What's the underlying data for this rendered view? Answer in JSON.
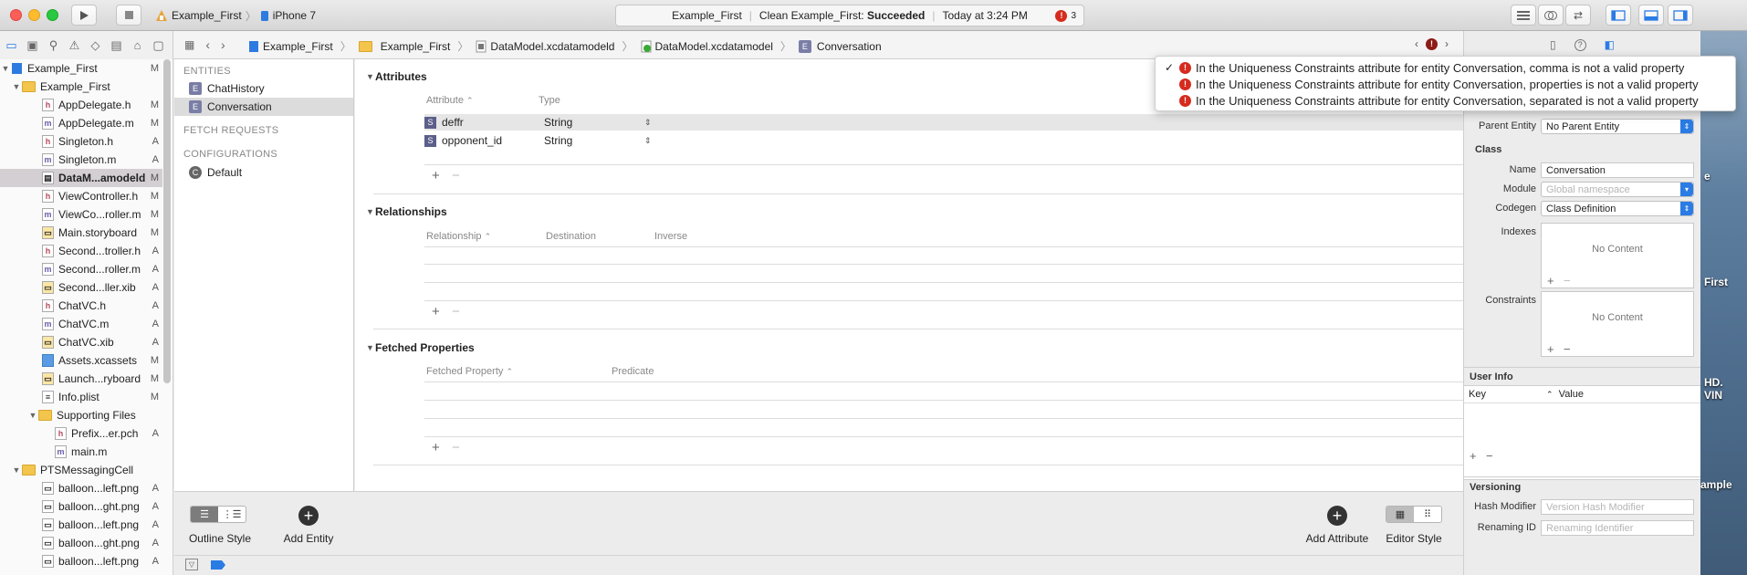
{
  "toolbar": {
    "scheme": "Example_First",
    "device": "iPhone 7",
    "activity_project": "Example_First",
    "activity_action": "Clean Example_First:",
    "activity_result": "Succeeded",
    "activity_time": "Today at 3:24 PM",
    "activity_error_count": "3"
  },
  "jumpbar": {
    "crumbs": [
      "Example_First",
      "Example_First",
      "DataModel.xcdatamodeld",
      "DataModel.xcdatamodel",
      "Conversation"
    ]
  },
  "navigator": {
    "items": [
      {
        "label": "Example_First",
        "status": "M"
      },
      {
        "label": "Example_First",
        "status": ""
      },
      {
        "label": "AppDelegate.h",
        "status": "M"
      },
      {
        "label": "AppDelegate.m",
        "status": "M"
      },
      {
        "label": "Singleton.h",
        "status": "A"
      },
      {
        "label": "Singleton.m",
        "status": "A"
      },
      {
        "label": "DataM...amodeld",
        "status": "M"
      },
      {
        "label": "ViewController.h",
        "status": "M"
      },
      {
        "label": "ViewCo...roller.m",
        "status": "M"
      },
      {
        "label": "Main.storyboard",
        "status": "M"
      },
      {
        "label": "Second...troller.h",
        "status": "A"
      },
      {
        "label": "Second...roller.m",
        "status": "A"
      },
      {
        "label": "Second...ller.xib",
        "status": "A"
      },
      {
        "label": "ChatVC.h",
        "status": "A"
      },
      {
        "label": "ChatVC.m",
        "status": "A"
      },
      {
        "label": "ChatVC.xib",
        "status": "A"
      },
      {
        "label": "Assets.xcassets",
        "status": "M"
      },
      {
        "label": "Launch...ryboard",
        "status": "M"
      },
      {
        "label": "Info.plist",
        "status": "M"
      },
      {
        "label": "Supporting Files",
        "status": ""
      },
      {
        "label": "Prefix...er.pch",
        "status": "A"
      },
      {
        "label": "main.m",
        "status": ""
      },
      {
        "label": "PTSMessagingCell",
        "status": ""
      },
      {
        "label": "balloon...left.png",
        "status": "A"
      },
      {
        "label": "balloon...ght.png",
        "status": "A"
      },
      {
        "label": "balloon...left.png",
        "status": "A"
      },
      {
        "label": "balloon...ght.png",
        "status": "A"
      },
      {
        "label": "balloon...left.png",
        "status": "A"
      }
    ]
  },
  "entities": {
    "entities_header": "ENTITIES",
    "entity1": "ChatHistory",
    "entity2": "Conversation",
    "fetch_header": "FETCH REQUESTS",
    "config_header": "CONFIGURATIONS",
    "config1": "Default"
  },
  "editor": {
    "attributes_title": "Attributes",
    "attr_col_attribute": "Attribute",
    "attr_col_type": "Type",
    "attributes": [
      {
        "name": "deffr",
        "type": "String"
      },
      {
        "name": "opponent_id",
        "type": "String"
      }
    ],
    "relationships_title": "Relationships",
    "rel_col_relationship": "Relationship",
    "rel_col_destination": "Destination",
    "rel_col_inverse": "Inverse",
    "fetched_title": "Fetched Properties",
    "fp_col_property": "Fetched Property",
    "fp_col_predicate": "Predicate"
  },
  "bottom": {
    "outline_style": "Outline Style",
    "add_entity": "Add Entity",
    "add_attribute": "Add Attribute",
    "editor_style": "Editor Style"
  },
  "popup": {
    "errors": [
      "In the Uniqueness Constraints attribute for entity Conversation, comma is not a valid property",
      "In the Uniqueness Constraints attribute for entity Conversation, properties is not a valid property",
      "In the Uniqueness Constraints attribute for entity Conversation, separated is not a valid property"
    ]
  },
  "inspector": {
    "parent_entity_label": "Parent Entity",
    "parent_entity_value": "No Parent Entity",
    "class_header": "Class",
    "name_label": "Name",
    "name_value": "Conversation",
    "module_label": "Module",
    "module_placeholder": "Global namespace",
    "codegen_label": "Codegen",
    "codegen_value": "Class Definition",
    "indexes_label": "Indexes",
    "indexes_empty": "No Content",
    "constraints_label": "Constraints",
    "constraints_empty": "No Content",
    "userinfo_header": "User Info",
    "key_col": "Key",
    "value_col": "Value",
    "versioning_header": "Versioning",
    "hash_label": "Hash Modifier",
    "hash_placeholder": "Version Hash Modifier",
    "renaming_label": "Renaming ID",
    "renaming_placeholder": "Renaming Identifier"
  },
  "desktop": {
    "t1": "e",
    "t2": "First",
    "t3": "HD.",
    "t4": "VIN",
    "t5": "ample"
  }
}
